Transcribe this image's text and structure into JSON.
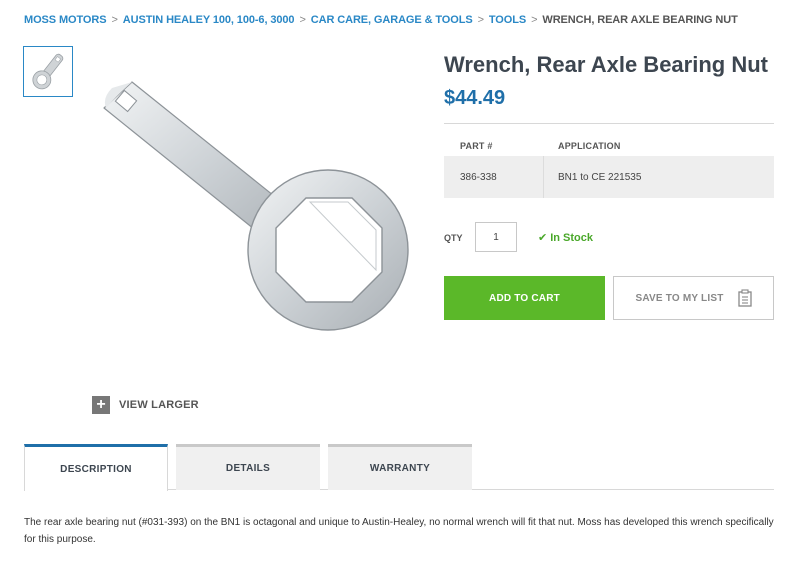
{
  "breadcrumb": {
    "items": [
      "MOSS MOTORS",
      "AUSTIN HEALEY 100, 100-6, 3000",
      "CAR CARE, GARAGE & TOOLS",
      "TOOLS"
    ],
    "separator": ">",
    "current": "WRENCH, REAR AXLE BEARING NUT"
  },
  "gallery": {
    "view_larger": "VIEW LARGER",
    "plus_symbol": "+"
  },
  "product": {
    "title": "Wrench, Rear Axle Bearing Nut",
    "price": "$44.49"
  },
  "part_table": {
    "headers": {
      "part": "PART #",
      "application": "APPLICATION"
    },
    "row": {
      "part": "386-338",
      "application": "BN1 to CE 221535"
    }
  },
  "purchase": {
    "qty_label": "QTY",
    "qty_value": "1",
    "stock_check": "✔",
    "stock_status": "In Stock",
    "add_to_cart": "ADD TO CART",
    "save_to_list": "SAVE TO MY LIST"
  },
  "tabs": [
    {
      "label": "DESCRIPTION",
      "active": true
    },
    {
      "label": "DETAILS",
      "active": false
    },
    {
      "label": "WARRANTY",
      "active": false
    }
  ],
  "description": "The rear axle bearing nut (#031-393) on the BN1 is octagonal and unique to Austin-Healey, no normal wrench will fit that nut. Moss has developed this wrench specifically for this purpose.",
  "colors": {
    "link_blue": "#2a88c6",
    "price_blue": "#1f6fa9",
    "cart_green": "#5bb829",
    "stock_green": "#4aa82a"
  },
  "icons": {
    "thumbnail": "wrench-thumbnail-icon",
    "view_larger": "plus-icon",
    "stock": "checkmark-icon",
    "save_list": "clipboard-icon"
  }
}
